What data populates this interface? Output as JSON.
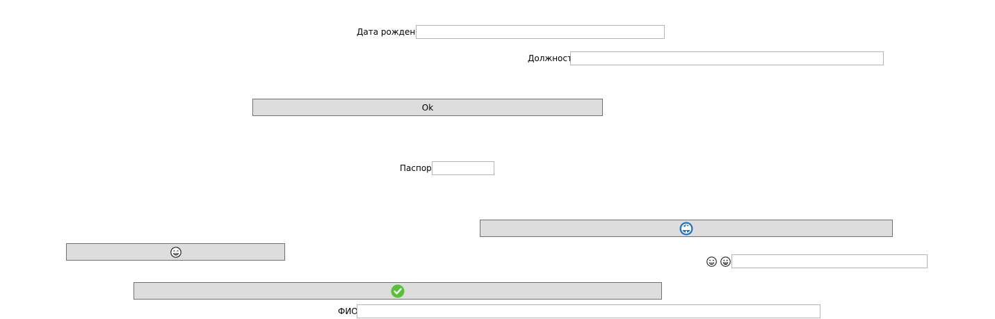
{
  "form": {
    "birth_date": {
      "label": "Дата рождения",
      "value": ""
    },
    "position": {
      "label": "Должность",
      "value": ""
    },
    "passport": {
      "label": "Паспорт",
      "value": ""
    },
    "full_name": {
      "label": "ФИО",
      "value": ""
    },
    "emoji_field": {
      "value": ""
    }
  },
  "buttons": {
    "ok": {
      "label": "Ok"
    },
    "globe": {
      "icon": "globe-icon",
      "color": "#1e73be"
    },
    "grin_small": {
      "icon": "grinning-face-icon"
    },
    "check": {
      "icon": "checkmark-icon",
      "color": "#5cbf3c"
    }
  },
  "icons": {
    "emoji_prefix": [
      "grinning-face-icon",
      "smiling-face-icon"
    ]
  }
}
